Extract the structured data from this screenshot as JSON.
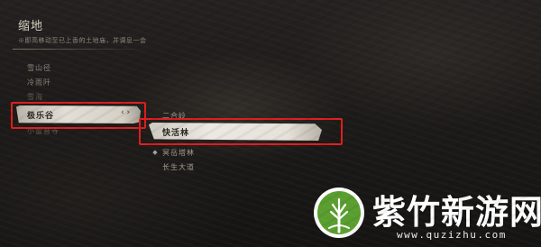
{
  "header": {
    "title": "缩地",
    "subtitle": "※即高移动至已上香的土地庙，并调息一会"
  },
  "left_list": {
    "items": [
      {
        "label": "雪山径"
      },
      {
        "label": "冷雨阡"
      },
      {
        "label": "雪海"
      },
      {
        "label": "极乐谷",
        "selected": true
      },
      {
        "label": "小雷音寺"
      }
    ],
    "selected_chevron": "‹ ›"
  },
  "sub_list": {
    "items": [
      {
        "label": "二合岭"
      },
      {
        "label": "快活林",
        "selected": true
      },
      {
        "label": "冥岳塔林",
        "icon": "map-marker-icon"
      },
      {
        "label": "长生大道"
      }
    ]
  },
  "highlights": {
    "color": "#e01d1d"
  },
  "watermark": {
    "title": "紫竹新游网",
    "url": "www.quzizhu.com",
    "logo_icon": "bamboo-tree-icon",
    "logo_color": "#5a9e2f"
  }
}
